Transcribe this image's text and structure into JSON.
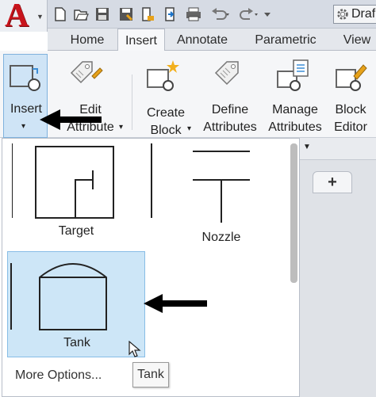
{
  "quick_access": {
    "app_logo": "A",
    "document_title": "Draf",
    "icons": [
      "new-icon",
      "open-icon",
      "save-icon",
      "save-as-icon",
      "export-icon",
      "share-icon",
      "print-icon",
      "undo-icon",
      "redo-icon",
      "workspace-gear-icon"
    ]
  },
  "tabs": [
    {
      "label": "Home",
      "active": false
    },
    {
      "label": "Insert",
      "active": true
    },
    {
      "label": "Annotate",
      "active": false
    },
    {
      "label": "Parametric",
      "active": false
    },
    {
      "label": "View",
      "active": false
    }
  ],
  "ribbon": {
    "insert": {
      "line1": "Insert",
      "caret": "▾"
    },
    "edit_attribute": {
      "line1": "Edit",
      "line2": "Attribute",
      "caret": "▾"
    },
    "create_block": {
      "line1": "Create",
      "line2": "Block",
      "caret": "▾"
    },
    "define_attributes": {
      "line1": "Define",
      "line2": "Attributes"
    },
    "manage_attributes": {
      "line1": "Manage",
      "line2": "Attributes"
    },
    "block_editor": {
      "line1": "Block",
      "line2": "Editor"
    }
  },
  "gallery": {
    "items": [
      {
        "label": "Target",
        "selected": false
      },
      {
        "label": "Nozzle",
        "selected": false
      },
      {
        "label": "Tank",
        "selected": true
      }
    ],
    "more_options": "More Options...",
    "tooltip": "Tank"
  },
  "drawing_tabs": {
    "new_tab_symbol": "+"
  },
  "colors": {
    "accent_selected": "#cde6f7",
    "logo_red": "#c8141b",
    "arrow": "#000000"
  }
}
